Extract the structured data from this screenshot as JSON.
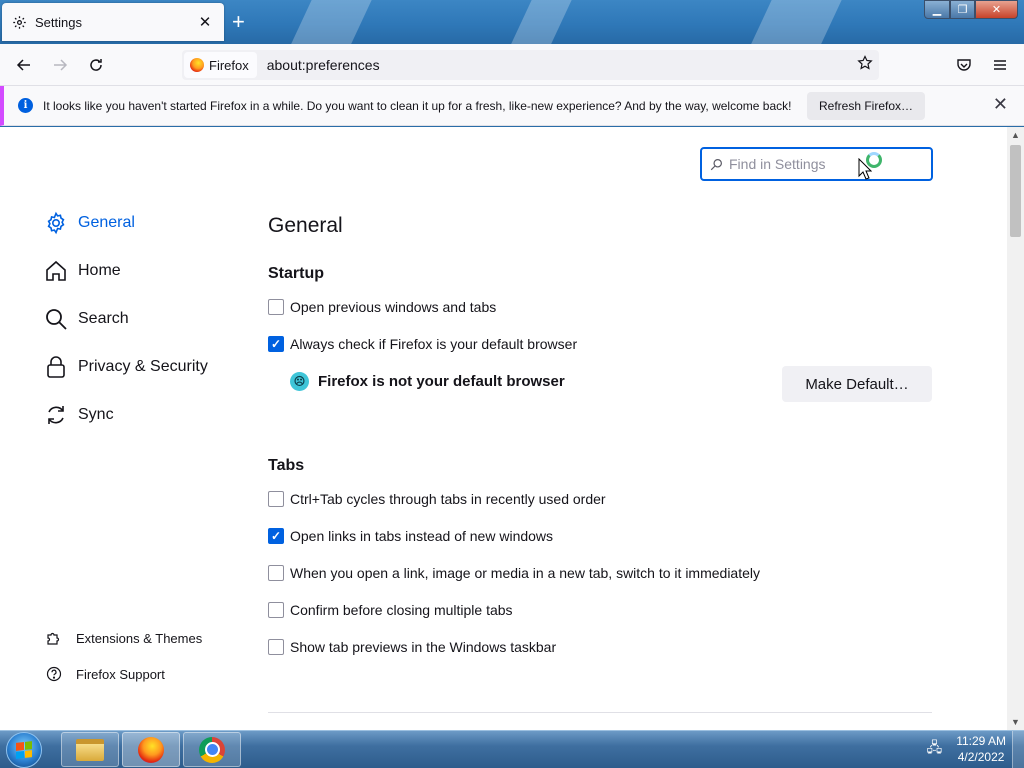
{
  "tab": {
    "title": "Settings",
    "close": "✕",
    "new_tab": "+"
  },
  "window_controls": {
    "minimize": "▁",
    "maximize": "❐",
    "close": "✕"
  },
  "navbar": {
    "identity_label": "Firefox",
    "url": "about:preferences"
  },
  "notification": {
    "text": "It looks like you haven't started Firefox in a while. Do you want to clean it up for a fresh, like-new experience? And by the way, welcome back!",
    "button": "Refresh Firefox…",
    "close": "✕"
  },
  "search": {
    "placeholder": "Find in Settings"
  },
  "sidebar": {
    "items": [
      {
        "label": "General",
        "icon": "gear-icon",
        "active": true
      },
      {
        "label": "Home",
        "icon": "home-icon"
      },
      {
        "label": "Search",
        "icon": "search-icon"
      },
      {
        "label": "Privacy & Security",
        "icon": "lock-icon"
      },
      {
        "label": "Sync",
        "icon": "sync-icon"
      }
    ],
    "footer": [
      {
        "label": "Extensions & Themes",
        "icon": "puzzle-icon"
      },
      {
        "label": "Firefox Support",
        "icon": "help-icon"
      }
    ]
  },
  "main": {
    "title": "General",
    "startup": {
      "heading": "Startup",
      "options": [
        {
          "label": "Open previous windows and tabs",
          "checked": false
        },
        {
          "label": "Always check if Firefox is your default browser",
          "checked": true
        }
      ],
      "default_status": "Firefox is not your default browser",
      "make_default": "Make Default…"
    },
    "tabs": {
      "heading": "Tabs",
      "options": [
        {
          "label": "Ctrl+Tab cycles through tabs in recently used order",
          "checked": false
        },
        {
          "label": "Open links in tabs instead of new windows",
          "checked": true
        },
        {
          "label": "When you open a link, image or media in a new tab, switch to it immediately",
          "checked": false
        },
        {
          "label": "Confirm before closing multiple tabs",
          "checked": false
        },
        {
          "label": "Show tab previews in the Windows taskbar",
          "checked": false
        }
      ]
    }
  },
  "taskbar": {
    "time": "11:29 AM",
    "date": "4/2/2022"
  },
  "colors": {
    "accent": "#0061e0",
    "notification_stripe": "#d34bff"
  }
}
